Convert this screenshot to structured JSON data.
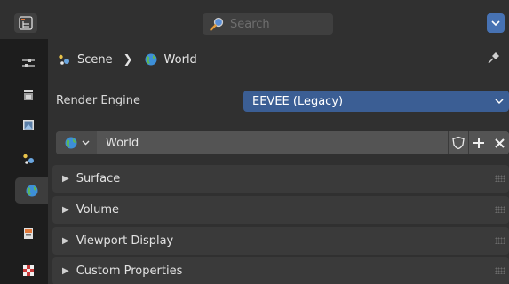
{
  "header": {
    "search_placeholder": "Search"
  },
  "tabs": [
    {
      "name": "tool",
      "icon": "tool-settings-icon"
    },
    {
      "name": "render",
      "icon": "render-icon"
    },
    {
      "name": "output",
      "icon": "output-icon"
    },
    {
      "name": "scene",
      "icon": "scene-icon"
    },
    {
      "name": "world",
      "icon": "world-icon",
      "active": true
    },
    {
      "name": "collection",
      "icon": "collection-icon"
    },
    {
      "name": "texture",
      "icon": "texture-icon"
    }
  ],
  "breadcrumb": {
    "scene_label": "Scene",
    "separator": "❯",
    "world_label": "World"
  },
  "render_engine": {
    "label": "Render Engine",
    "value": "EEVEE (Legacy)"
  },
  "world_datablock": {
    "name": "World"
  },
  "sections": [
    {
      "label": "Surface"
    },
    {
      "label": "Volume"
    },
    {
      "label": "Viewport Display"
    },
    {
      "label": "Custom Properties"
    }
  ],
  "colors": {
    "accent": "#4772b3",
    "select_blue": "#3b5e94",
    "panel_bg": "#303030",
    "tab_bg": "#1d1d1d"
  }
}
